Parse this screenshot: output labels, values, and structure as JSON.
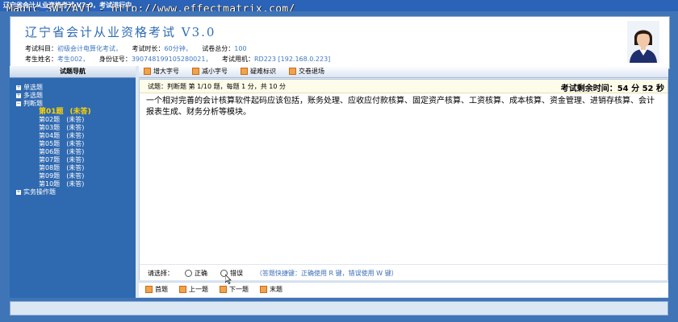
{
  "window": {
    "title": "辽宁省会计从业资格考试 V3.0，考试进行中",
    "watermark": "Magic SWIZAVI - http://www.effectmatrix.com/"
  },
  "header": {
    "title": "辽宁省会计从业资格考试 V3.0",
    "subject_label": "考试科目：",
    "subject_value": "初级会计电算化考试，",
    "duration_label": "考试时长：",
    "duration_value": "60分钟，",
    "total_label": "试卷总分：",
    "total_value": "100",
    "name_label": "考生姓名：",
    "name_value": "考生002，",
    "id_label": "身份证号：",
    "id_value": "390748199105280021，",
    "machine_label": "考试用机：",
    "machine_value": "RD223 [192.168.0.223]"
  },
  "sidebar": {
    "title": "试题导航",
    "sections": [
      {
        "icon": "+",
        "label": "单选题"
      },
      {
        "icon": "+",
        "label": "多选题"
      },
      {
        "icon": "−",
        "label": "判断题"
      }
    ],
    "items": [
      {
        "label": "第01题",
        "status": "(未答)"
      },
      {
        "label": "第02题",
        "status": "(未答)"
      },
      {
        "label": "第03题",
        "status": "(未答)"
      },
      {
        "label": "第04题",
        "status": "(未答)"
      },
      {
        "label": "第05题",
        "status": "(未答)"
      },
      {
        "label": "第06题",
        "status": "(未答)"
      },
      {
        "label": "第07题",
        "status": "(未答)"
      },
      {
        "label": "第08题",
        "status": "(未答)"
      },
      {
        "label": "第09题",
        "status": "(未答)"
      },
      {
        "label": "第10题",
        "status": "(未答)"
      }
    ],
    "last_section": {
      "icon": "+",
      "label": "实务操作题"
    }
  },
  "toolbar": {
    "enlarge": "增大字号",
    "shrink": "减小字号",
    "flag": "疑难标识",
    "submit": "交卷退场"
  },
  "question": {
    "info": "试题：判断题 第 1/10 题，每题 1 分，共 10 分",
    "timer": "考试剩余时间：54 分 52 秒",
    "text": "一个相对完善的会计核算软件起码应该包括，账务处理、应收应付款核算、固定资产核算、工资核算、成本核算、资金管理、进销存核算、会计报表生成、财务分析等模块。"
  },
  "answer": {
    "prompt": "请选择：",
    "options": [
      "正确",
      "错误"
    ],
    "hint": "（答题快捷键：正确使用 R 键，错误使用 W 键）"
  },
  "nav": {
    "first": "首题",
    "prev": "上一题",
    "next": "下一题",
    "last": "末题"
  },
  "colors": {
    "frame": "#3f75b7",
    "sidebar": "#2f69b0",
    "active_item": "#ffd100",
    "title_blue": "#2f6db5",
    "value_blue": "#3f77c2"
  },
  "icons": [
    "avatar-photo",
    "toolbar-button-icon",
    "tree-expand-icon",
    "tree-collapse-icon",
    "radio-icon",
    "mouse-cursor-icon"
  ]
}
